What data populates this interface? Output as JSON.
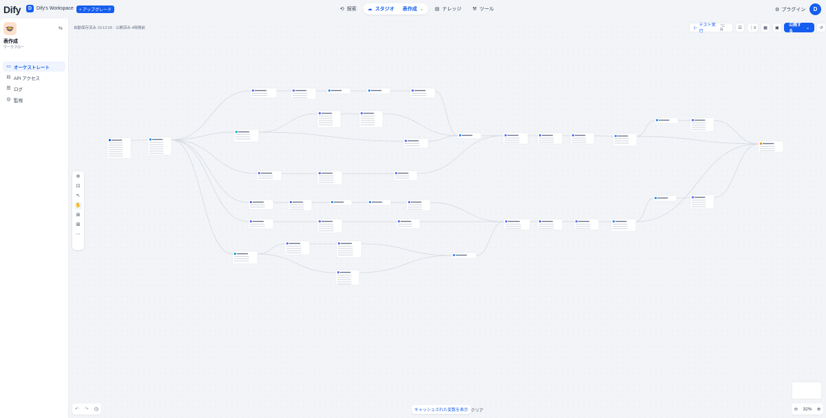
{
  "topbar": {
    "logo": "Dify",
    "workspace_initial": "D",
    "workspace_name": "Dify's Workspace",
    "upgrade_label": "+ アップグレード",
    "nav": [
      {
        "label": "探索",
        "icon": "explore-icon"
      },
      {
        "label": "スタジオ",
        "icon": "studio-icon",
        "active": true,
        "sub": "表作成"
      },
      {
        "label": "ナレッジ",
        "icon": "knowledge-icon"
      },
      {
        "label": "ツール",
        "icon": "tools-icon"
      }
    ],
    "plugin_label": "プラグイン",
    "user_initial": "D"
  },
  "sidebar": {
    "app_name": "表作成",
    "app_type": "ワークフロー",
    "items": [
      {
        "label": "オーケストレート",
        "active": true
      },
      {
        "label": "API アクセス"
      },
      {
        "label": "ログ"
      },
      {
        "label": "監視"
      }
    ]
  },
  "canvas": {
    "autosave": "自動保存済み 10:12:03 · 公開済み 4時間前",
    "run_label": "テスト実行",
    "run_shortcut": "⌥ R",
    "publish_label": "公開する",
    "cache_label": "キャッシュされた変数を表示",
    "clear_label": "クリア",
    "zoom_level": "32%"
  },
  "colors": {
    "accent": "#155eef",
    "start_node": "#155eef",
    "llm_node": "#6172f3",
    "code_node": "#2e90fa",
    "branch_node": "#06aed4",
    "end_node": "#f79009"
  }
}
